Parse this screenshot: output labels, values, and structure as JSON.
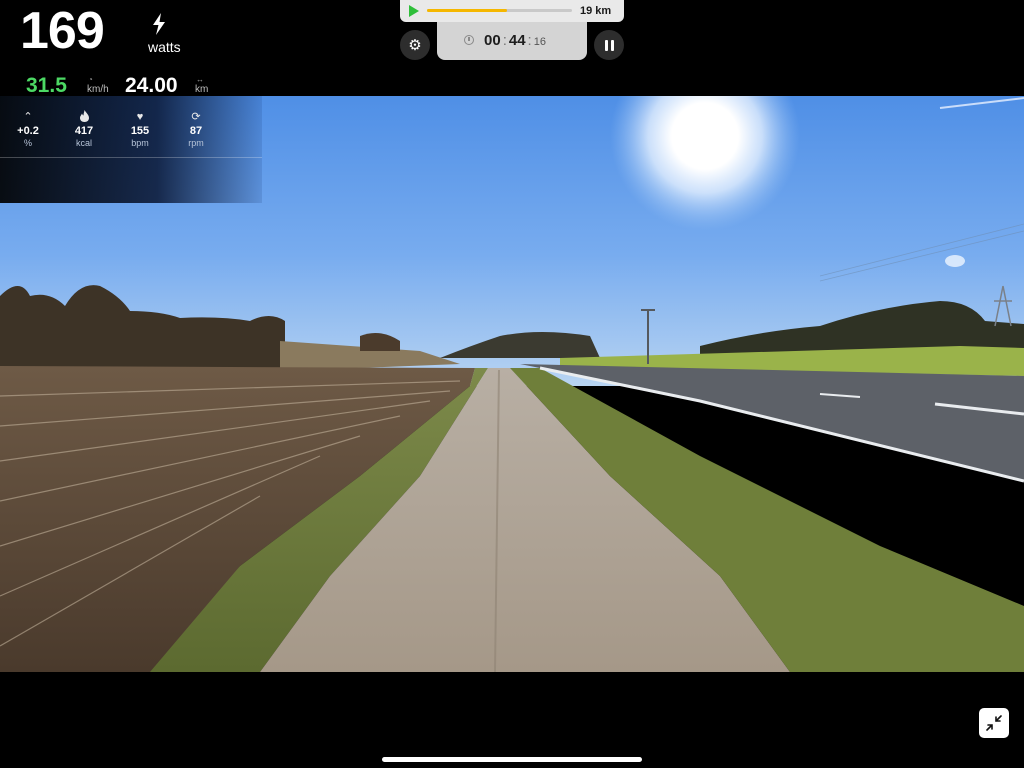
{
  "power": {
    "value": "169",
    "unit": "watts",
    "icon": "bolt-icon"
  },
  "speed": {
    "value": "31.5",
    "unit": "km/h",
    "icon": "speedometer-icon"
  },
  "distance": {
    "value": "24.00",
    "unit": "km",
    "icon": "route-icon"
  },
  "metrics": [
    {
      "icon": "incline-icon",
      "value": "+0.2",
      "unit": "%"
    },
    {
      "icon": "flame-icon",
      "value": "417",
      "unit": "kcal"
    },
    {
      "icon": "heart-icon",
      "value": "155",
      "unit": "bpm"
    },
    {
      "icon": "cadence-icon",
      "value": "87",
      "unit": "rpm"
    }
  ],
  "route_progress": {
    "fraction": 0.55,
    "total_distance": "19 km"
  },
  "timer": {
    "hours": "00",
    "minutes": "44",
    "seconds": "16"
  },
  "controls": {
    "settings_icon": "gear-icon",
    "pause_icon": "pause-icon",
    "collapse_icon": "collapse-arrows-icon"
  },
  "colors": {
    "speed": "#4cd964",
    "progress_fill": "#f5b700",
    "play": "#2fbf3a"
  }
}
